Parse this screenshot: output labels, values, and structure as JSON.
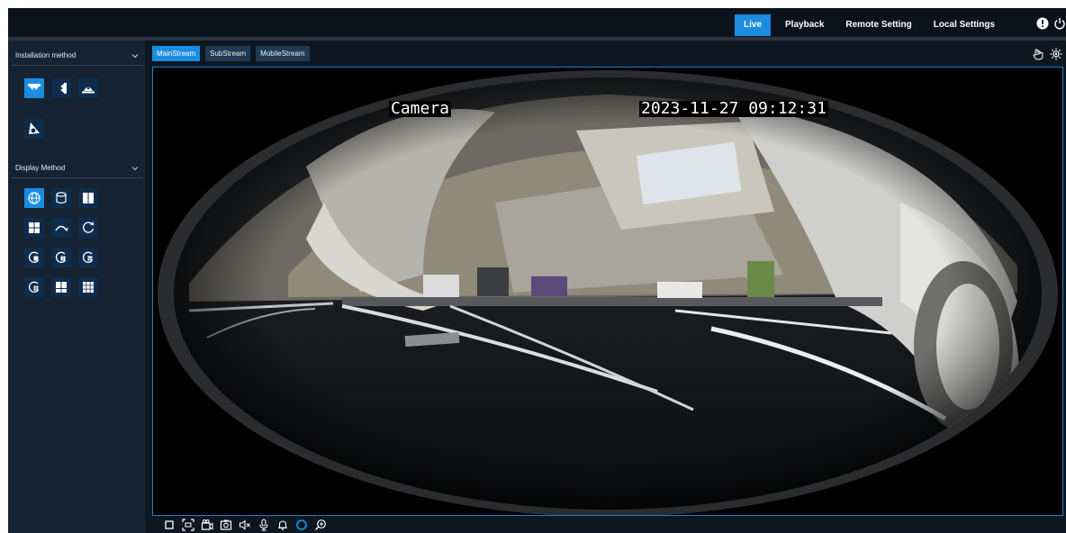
{
  "nav": {
    "items": [
      {
        "label": "Live",
        "active": true
      },
      {
        "label": "Playback",
        "active": false
      },
      {
        "label": "Remote Setting",
        "active": false
      },
      {
        "label": "Local Settings",
        "active": false
      }
    ],
    "icons": [
      "alert-icon",
      "power-icon"
    ]
  },
  "sidebar": {
    "installation_label": "Installation method",
    "installation_icons": [
      "ceiling-mount-icon",
      "wall-mount-icon",
      "desktop-mount-icon",
      "tilt-mount-icon"
    ],
    "display_label": "Display Method",
    "display_icons": [
      "fisheye-original-icon",
      "cylinder-view-icon",
      "dual-panorama-icon",
      "quad-view-icon",
      "panorama-180-icon",
      "panorama-360-icon",
      "fisheye-plus-one-icon",
      "fisheye-plus-two-icon",
      "fisheye-plus-three-icon",
      "fisheye-plus-four-icon",
      "four-split-icon",
      "nine-split-icon"
    ]
  },
  "streams": {
    "tabs": [
      {
        "label": "MainStream",
        "active": true
      },
      {
        "label": "SubStream",
        "active": false
      },
      {
        "label": "MobileStream",
        "active": false
      }
    ]
  },
  "video": {
    "camera_name": "Camera",
    "timestamp": "2023-11-27 09:12:31"
  },
  "right_tools": [
    "ptz-hand-icon",
    "image-settings-icon"
  ],
  "bottom_tools": [
    "stop-icon",
    "fullscreen-icon",
    "record-icon",
    "snapshot-icon",
    "audio-mute-icon",
    "microphone-icon",
    "alarm-icon",
    "spinner-icon",
    "zoom-icon"
  ],
  "colors": {
    "accent": "#1a8de0",
    "background": "#0d1722",
    "sidebar": "#162332",
    "button": "#0e2d4d"
  }
}
